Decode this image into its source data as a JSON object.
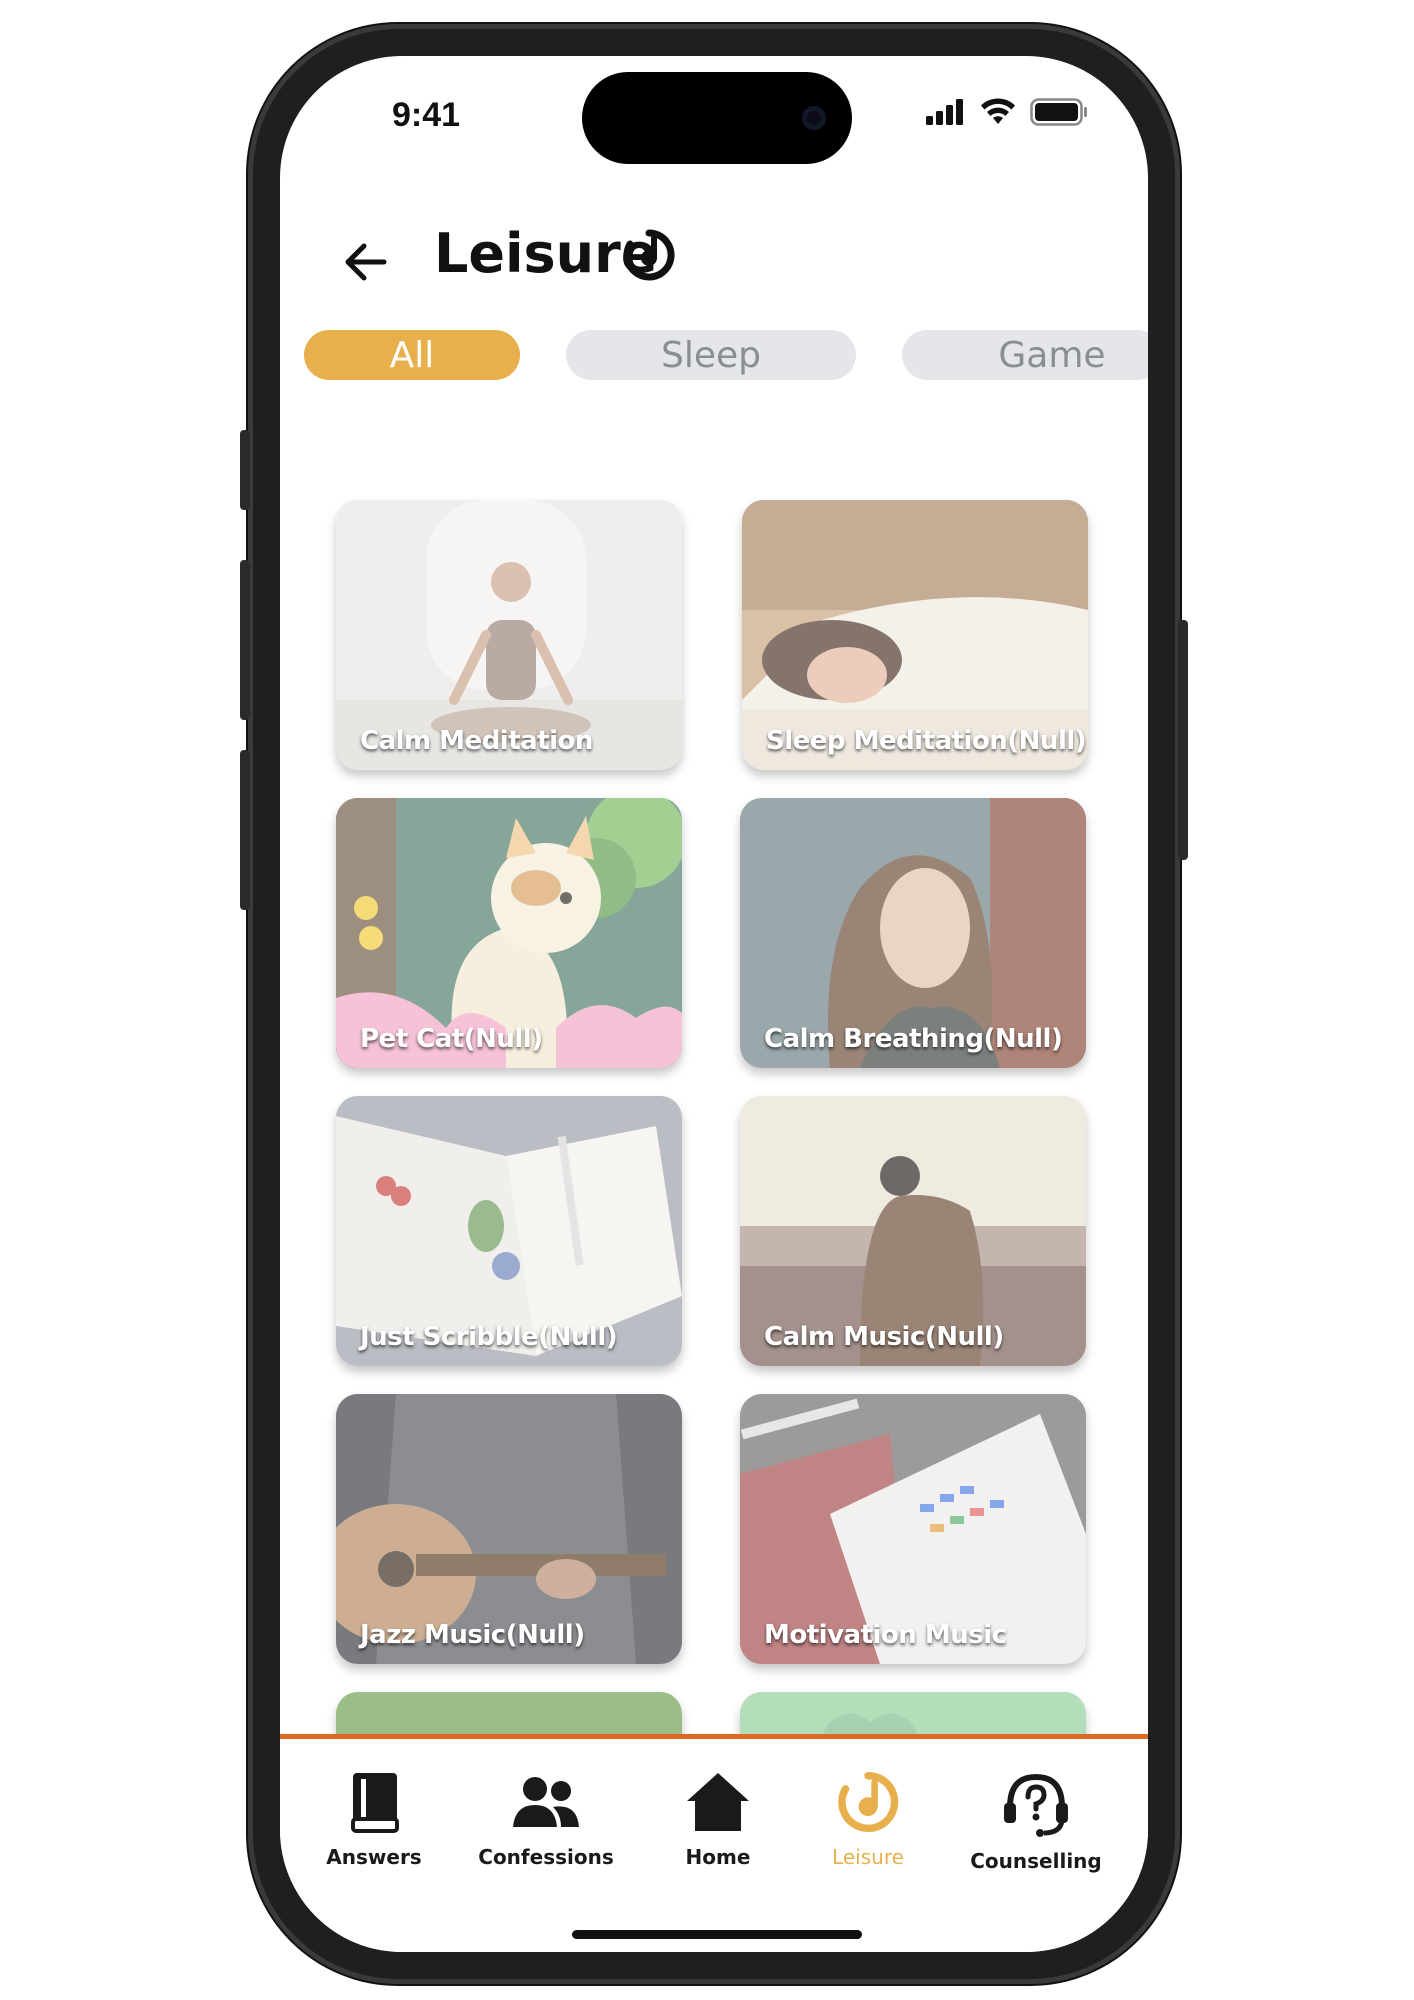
{
  "status": {
    "time": "9:41"
  },
  "header": {
    "title": "Leisure"
  },
  "filters": [
    {
      "label": "All",
      "active": true
    },
    {
      "label": "Sleep",
      "active": false
    },
    {
      "label": "Game",
      "active": false
    }
  ],
  "cards": [
    {
      "label": "Calm Meditation"
    },
    {
      "label": "Sleep Meditation(Null)"
    },
    {
      "label": "Pet Cat(Null)"
    },
    {
      "label": "Calm Breathing(Null)"
    },
    {
      "label": "Just Scribble(Null)"
    },
    {
      "label": "Calm Music(Null)"
    },
    {
      "label": "Jazz Music(Null)"
    },
    {
      "label": "Motivation Music"
    }
  ],
  "nav": [
    {
      "label": "Answers",
      "icon": "book-icon",
      "active": false
    },
    {
      "label": "Confessions",
      "icon": "people-icon",
      "active": false
    },
    {
      "label": "Home",
      "icon": "home-icon",
      "active": false
    },
    {
      "label": "Leisure",
      "icon": "leisure-icon",
      "active": true
    },
    {
      "label": "Counselling",
      "icon": "headset-question-icon",
      "active": false
    }
  ],
  "colors": {
    "accent": "#e8b04c",
    "divider": "#dc6a22",
    "chip_inactive": "#e5e6e9"
  }
}
